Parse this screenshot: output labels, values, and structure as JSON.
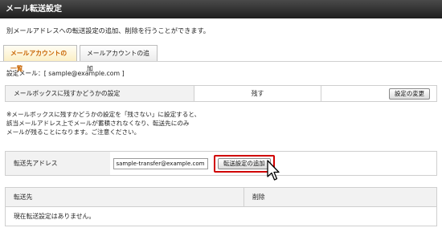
{
  "header": {
    "title": "メール転送設定"
  },
  "description": "別メールアドレスへの転送設定の追加、削除を行うことができます。",
  "tabs": [
    {
      "label": "メールアカウントの一覧",
      "active": true
    },
    {
      "label": "メールアカウントの追加",
      "active": false
    }
  ],
  "setting_email": {
    "text": "設定メール：[ sample@example.com ]"
  },
  "mailbox": {
    "label": "メールボックスに残すかどうかの設定",
    "value": "残す",
    "button": "設定の変更"
  },
  "note": {
    "line1": "※メールボックスに残すかどうかの設定を「残さない」に設定すると、",
    "line2": "該当メールアドレス上でメールが蓄積されなくなり、転送先にのみ",
    "line3": "メールが残ることになります。ご注意ください。"
  },
  "forward": {
    "label": "転送先アドレス",
    "input_value": "sample-transfer@example.com",
    "add_button": "転送設定の追加"
  },
  "list": {
    "col_dest": "転送先",
    "col_delete": "削除",
    "empty_text": "現在転送設定はありません。"
  },
  "colors": {
    "header_bg": "#2b2b2b",
    "tab_active_text": "#c86400",
    "highlight_border": "#d10000"
  },
  "icons": {
    "cursor": "mouse-pointer-icon"
  }
}
